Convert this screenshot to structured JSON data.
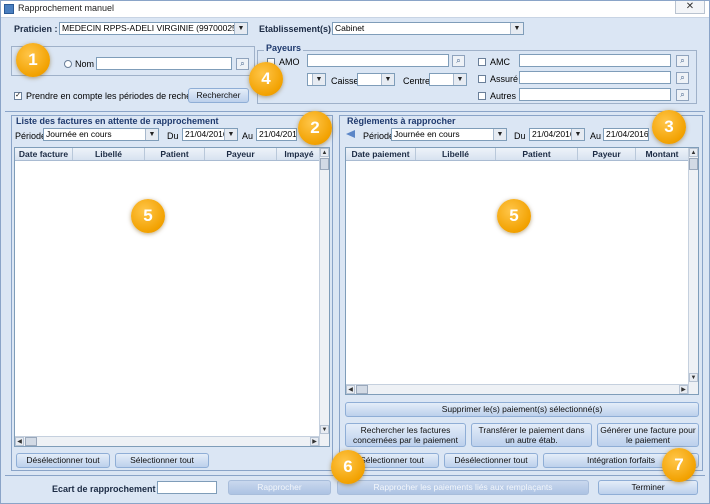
{
  "window": {
    "title": "Rapprochement manuel",
    "close": "✕"
  },
  "header": {
    "praticien_label": "Praticien :",
    "praticien_value": "MEDECIN RPPS-ADELI VIRGINIE (99700025150)",
    "etablissement_label": "Etablissement(s) :",
    "etablissement_value": "Cabinet"
  },
  "search": {
    "radio_nom_label": "Nom",
    "periods_checkbox_label": "Prendre en compte les périodes de recherche.",
    "search_button": "Rechercher"
  },
  "payeurs": {
    "title": "Payeurs",
    "amo": "AMO",
    "amc": "AMC",
    "assure": "Assuré",
    "autres": "Autres",
    "caisse": "Caisse",
    "centre": "Centre"
  },
  "left_panel": {
    "title": "Liste des factures en attente de rapprochement",
    "periode_label": "Période",
    "periode_value": "Journée en cours",
    "du_label": "Du",
    "du_value": "21/04/2016",
    "au_label": "Au",
    "au_value": "21/04/2016",
    "columns": [
      "Date facture",
      "Libellé",
      "Patient",
      "Payeur",
      "Impayé"
    ],
    "deselect_all": "Désélectionner tout",
    "select_all": "Sélectionner tout"
  },
  "right_panel": {
    "title": "Règlements à rapprocher",
    "periode_label": "Période",
    "periode_value": "Journée en cours",
    "du_label": "Du",
    "du_value": "21/04/2016",
    "au_label": "Au",
    "au_value": "21/04/2016",
    "columns": [
      "Date paiement",
      "Libellé",
      "Patient",
      "Payeur",
      "Montant"
    ],
    "delete_selected": "Supprimer le(s) paiement(s) sélectionné(s)",
    "search_invoices": "Rechercher les factures concernées par le paiement",
    "transfer_payment": "Transférer le paiement dans un autre étab.",
    "generate_invoice": "Générer une facture pour le paiement",
    "select_all": "Sélectionner tout",
    "deselect_all": "Désélectionner tout",
    "integration": "Intégration forfaits"
  },
  "footer": {
    "ecart_label": "Ecart de rapprochement :",
    "rapprocher": "Rapprocher",
    "rapprocher_remplacants": "Rapprocher les paiements liés aux remplaçants",
    "terminer": "Terminer"
  },
  "badges": [
    "1",
    "2",
    "3",
    "4",
    "5",
    "5",
    "6",
    "7"
  ],
  "colors": {
    "accent": "#f2a100",
    "panel_bg": "#dbe6f4",
    "button_top": "#e4edf9",
    "button_bottom": "#bcd0ec"
  }
}
